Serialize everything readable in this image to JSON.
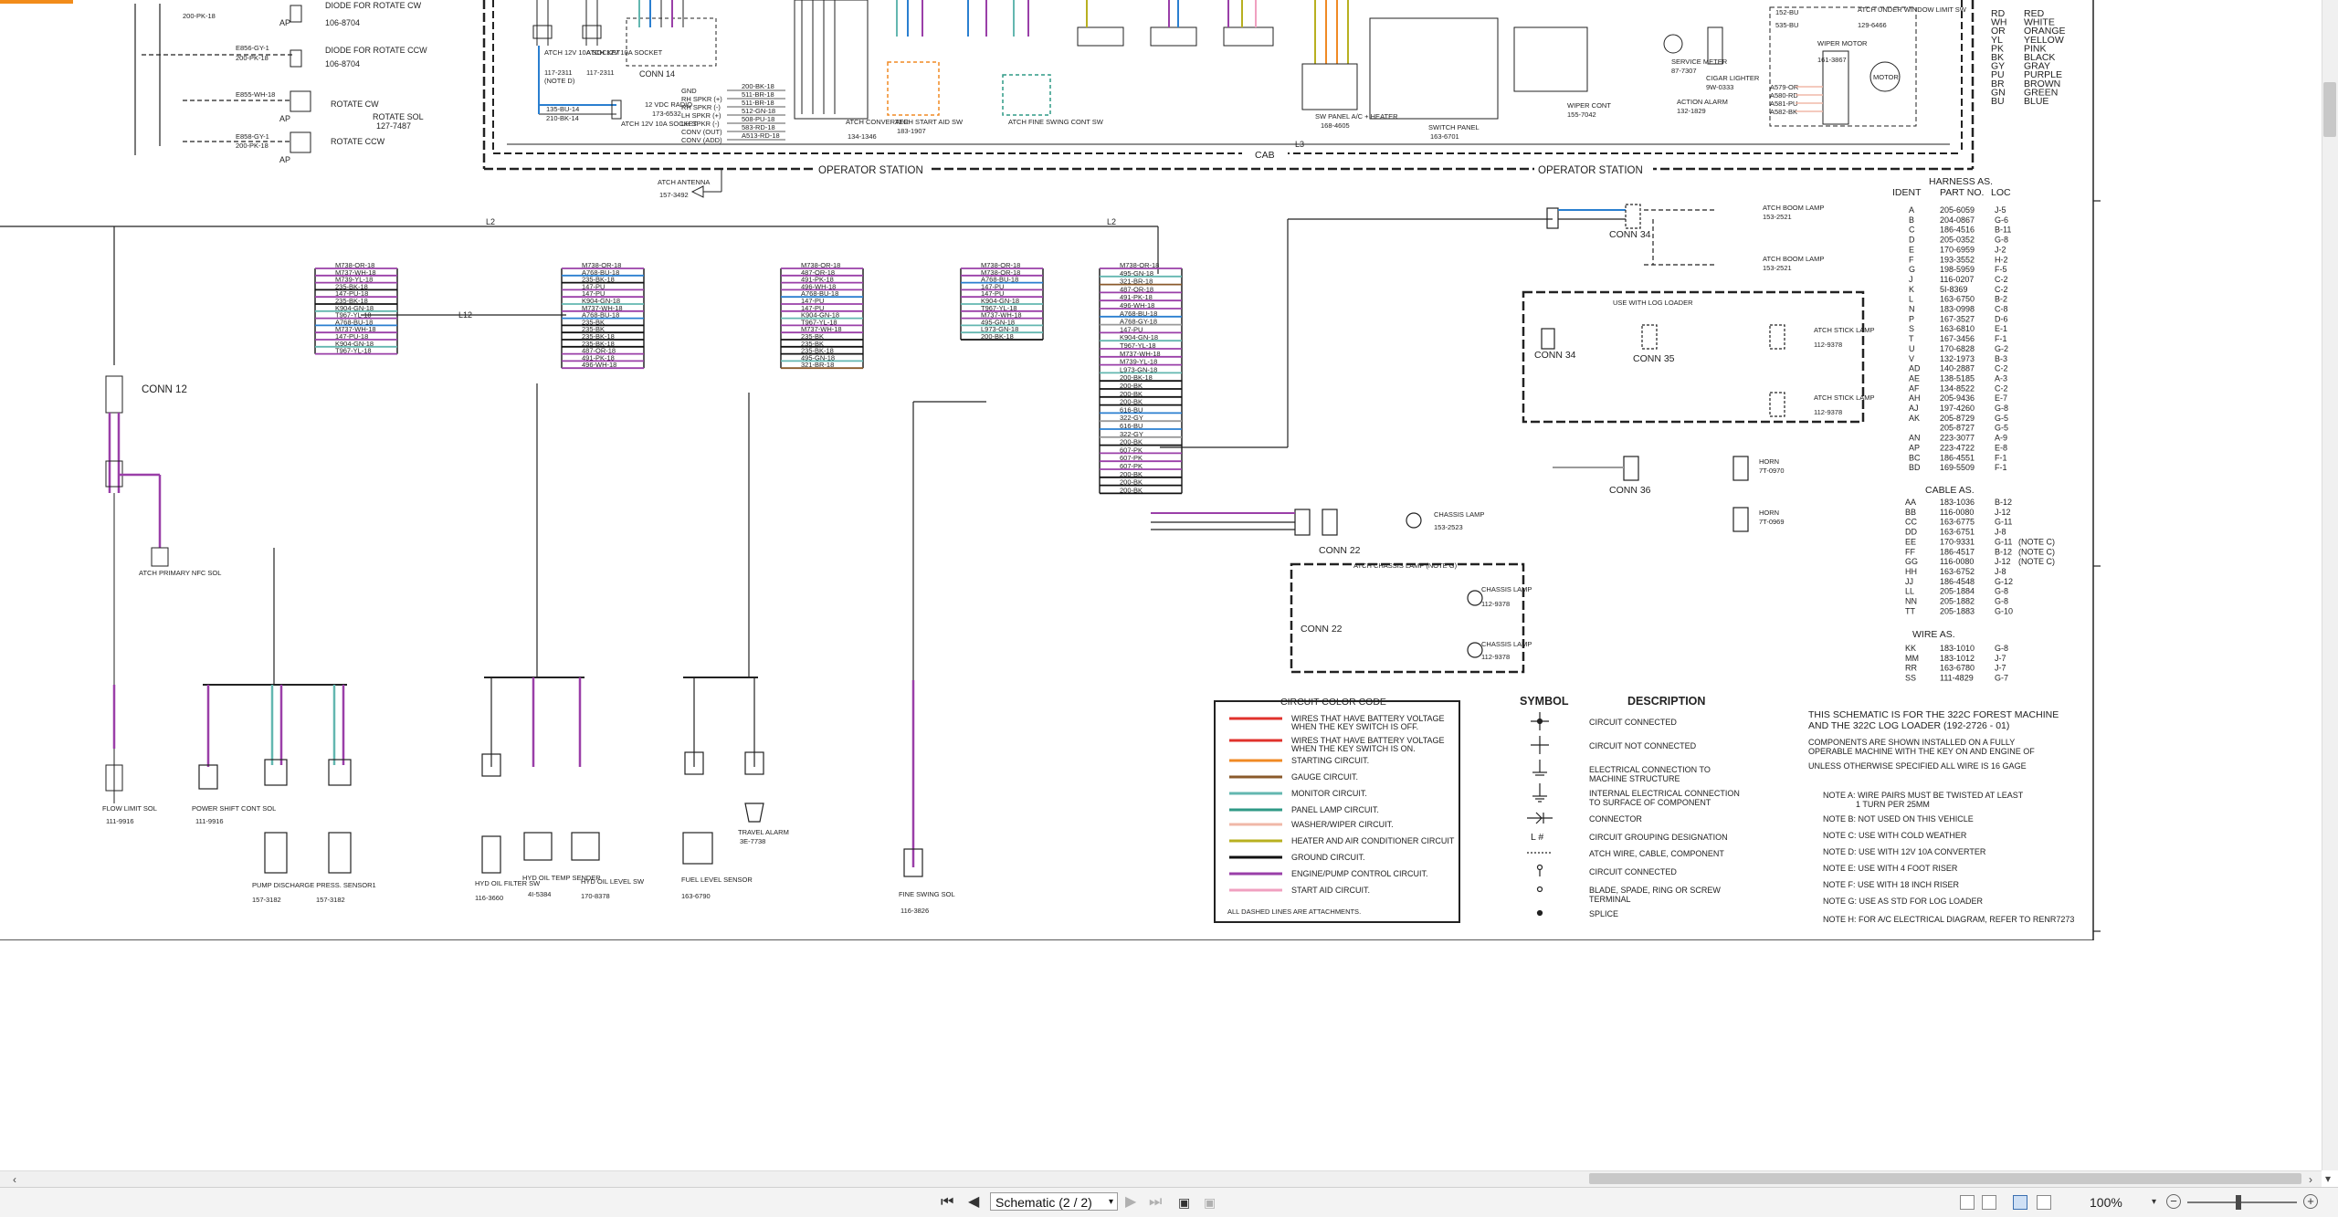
{
  "page_indicator": "Schematic (2 / 2)",
  "zoom": "100%",
  "grid": {
    "cols": [
      "8",
      "7",
      "6",
      "5",
      "4",
      "3",
      "2",
      "1"
    ],
    "rows": [
      "D",
      "C",
      "B",
      "A"
    ]
  },
  "colors": {
    "battery": "#e0322c",
    "keyswitch": "#e0322c",
    "starting": "#f08a24",
    "gauge": "#8a5a2b",
    "monitor": "#63b7b0",
    "panel_lamp": "#2f9a86",
    "washer": "#f0b8a8",
    "heater": "#b8b020",
    "ground": "#111111",
    "engine_pump": "#9a3fa8",
    "start_aid": "#f0a0c0",
    "blue_wire": "#2a7fd0"
  },
  "top": {
    "diode_cw": "DIODE FOR ROTATE CW",
    "diode_cw_pn": "106-8704",
    "diode_ccw": "DIODE FOR ROTATE CCW",
    "diode_ccw_pn": "106-8704",
    "wire_e856": "E856-GY-1",
    "wire_e855": "E855-WH-18",
    "wire_e858": "E858-GY-1",
    "wire_200pk": "200-PK-18",
    "rotate_cw": "ROTATE CW",
    "rotate_ccw": "ROTATE CCW",
    "rotate_sol": "ROTATE SOL",
    "rotate_sol_pn": "127-7487",
    "ap": "AP",
    "atch_socket": "ATCH 12V 10A SOCKET",
    "atch_socket_pn": "117-2311",
    "note_d": "(NOTE D)",
    "conn14": "CONN 14",
    "radio": "12 VDC RADIO",
    "radio_pn": "173-6532",
    "atch_converter": "ATCH CONVERTER",
    "converter_pn": "134-1346",
    "atch_start_aid": "ATCH START AID SW",
    "start_aid_pn": "183-1907",
    "atch_fine_swing": "ATCH FINE SWING CONT SW",
    "cab": "CAB",
    "operator_station": "OPERATOR STATION",
    "atch_antenna": "ATCH ANTENNA",
    "antenna_pn": "157-3492",
    "sw_panel": "SW PANEL A/C + HEATER",
    "sw_panel_pn": "168-4605",
    "switch_panel": "SWITCH PANEL",
    "switch_panel_pn": "163-6701",
    "wiper_cont": "WIPER CONT",
    "wiper_cont_pn": "155-7042",
    "action_alarm": "ACTION ALARM",
    "action_alarm_pn": "132-1829",
    "service_meter": "SERVICE METER",
    "service_meter_pn": "87-7307",
    "cigar_lighter": "CIGAR LIGHTER",
    "cigar_pn": "9W-0333",
    "wiper_motor": "WIPER MOTOR",
    "wiper_motor_pn": "161-3867",
    "motor": "MOTOR",
    "atch_under_window": "ATCH UNDER WINDOW LIMIT SW",
    "under_window_pn": "129-6466",
    "l3": "L3",
    "radio_wires": [
      "GND",
      "RH SPKR (+)",
      "RH SPKR (-)",
      "LH SPKR (+)",
      "LH SPKR (-)",
      "CONV (OUT)",
      "CONV (ADD)"
    ],
    "radio_nums": [
      "200-BK-18",
      "511-BR-18",
      "511-BR-18",
      "512-GN-18",
      "508-PU-18",
      "583-RD-18",
      "A513-RD-18"
    ],
    "wiper_wires": [
      "A579-OR",
      "A580-RD",
      "A581-PU",
      "A582-BK"
    ],
    "wire_152": "152-BU",
    "wire_535": "535-BU",
    "wire_135": "135-BU-14",
    "wire_210": "210-BK-14"
  },
  "colors_legend": [
    {
      "code": "RD",
      "name": "RED"
    },
    {
      "code": "WH",
      "name": "WHITE"
    },
    {
      "code": "OR",
      "name": "ORANGE"
    },
    {
      "code": "YL",
      "name": "YELLOW"
    },
    {
      "code": "PK",
      "name": "PINK"
    },
    {
      "code": "BK",
      "name": "BLACK"
    },
    {
      "code": "GY",
      "name": "GRAY"
    },
    {
      "code": "PU",
      "name": "PURPLE"
    },
    {
      "code": "BR",
      "name": "BROWN"
    },
    {
      "code": "GN",
      "name": "GREEN"
    },
    {
      "code": "BU",
      "name": "BLUE"
    }
  ],
  "harness": {
    "title": "HARNESS AS.",
    "headers": [
      "IDENT",
      "PART NO.",
      "LOC"
    ],
    "rows": [
      [
        "A",
        "205-6059",
        "J-5"
      ],
      [
        "B",
        "204-0867",
        "G-6"
      ],
      [
        "C",
        "186-4516",
        "B-11"
      ],
      [
        "D",
        "205-0352",
        "G-8"
      ],
      [
        "E",
        "170-6959",
        "J-2"
      ],
      [
        "F",
        "193-3552",
        "H-2"
      ],
      [
        "G",
        "198-5959",
        "F-5"
      ],
      [
        "J",
        "116-0207",
        "C-2"
      ],
      [
        "K",
        "5I-8369",
        "C-2"
      ],
      [
        "L",
        "163-6750",
        "B-2"
      ],
      [
        "N",
        "183-0998",
        "C-8"
      ],
      [
        "P",
        "167-3527",
        "D-6"
      ],
      [
        "S",
        "163-6810",
        "E-1"
      ],
      [
        "T",
        "167-3456",
        "F-1"
      ],
      [
        "U",
        "170-6828",
        "G-2"
      ],
      [
        "V",
        "132-1973",
        "B-3"
      ],
      [
        "AD",
        "140-2887",
        "C-2"
      ],
      [
        "AE",
        "138-5185",
        "A-3"
      ],
      [
        "AF",
        "134-8522",
        "C-2"
      ],
      [
        "AH",
        "205-9436",
        "E-7"
      ],
      [
        "AJ",
        "197-4260",
        "G-8"
      ],
      [
        "AK",
        "205-8729",
        "G-5"
      ],
      [
        "",
        "205-8727",
        "G-5"
      ],
      [
        "AN",
        "223-3077",
        "A-9"
      ],
      [
        "AP",
        "223-4722",
        "E-8"
      ],
      [
        "BC",
        "186-4551",
        "F-1"
      ],
      [
        "BD",
        "169-5509",
        "F-1"
      ]
    ]
  },
  "cable": {
    "title": "CABLE AS.",
    "rows": [
      [
        "AA",
        "183-1036",
        "B-12",
        ""
      ],
      [
        "BB",
        "116-0080",
        "J-12",
        ""
      ],
      [
        "CC",
        "163-6775",
        "G-11",
        ""
      ],
      [
        "DD",
        "163-6751",
        "J-8",
        ""
      ],
      [
        "EE",
        "170-9331",
        "G-11",
        "(NOTE C)"
      ],
      [
        "FF",
        "186-4517",
        "B-12",
        "(NOTE C)"
      ],
      [
        "GG",
        "116-0080",
        "J-12",
        "(NOTE C)"
      ],
      [
        "HH",
        "163-6752",
        "J-8",
        ""
      ],
      [
        "JJ",
        "186-4548",
        "G-12",
        ""
      ],
      [
        "LL",
        "205-1884",
        "G-8",
        ""
      ],
      [
        "NN",
        "205-1882",
        "G-8",
        ""
      ],
      [
        "TT",
        "205-1883",
        "G-10",
        ""
      ]
    ]
  },
  "wire": {
    "title": "WIRE AS.",
    "rows": [
      [
        "KK",
        "183-1010",
        "G-8"
      ],
      [
        "MM",
        "183-1012",
        "J-7"
      ],
      [
        "RR",
        "163-6780",
        "J-7"
      ],
      [
        "SS",
        "111-4829",
        "G-7"
      ]
    ]
  },
  "circuit_legend": {
    "title": "CIRCUIT COLOR CODE",
    "items": [
      {
        "c": "#e0322c",
        "t1": "WIRES THAT HAVE BATTERY VOLTAGE",
        "t2": "WHEN THE KEY SWITCH IS OFF."
      },
      {
        "c": "#e0322c",
        "t1": "WIRES THAT HAVE BATTERY VOLTAGE",
        "t2": "WHEN THE KEY SWITCH IS ON."
      },
      {
        "c": "#f08a24",
        "t1": "STARTING CIRCUIT.",
        "t2": ""
      },
      {
        "c": "#8a5a2b",
        "t1": "GAUGE CIRCUIT.",
        "t2": ""
      },
      {
        "c": "#63b7b0",
        "t1": "MONITOR CIRCUIT.",
        "t2": ""
      },
      {
        "c": "#2f9a86",
        "t1": "PANEL LAMP CIRCUIT.",
        "t2": ""
      },
      {
        "c": "#f0b8a8",
        "t1": "WASHER/WIPER CIRCUIT.",
        "t2": ""
      },
      {
        "c": "#b8b020",
        "t1": "HEATER AND AIR CONDITIONER CIRCUIT",
        "t2": ""
      },
      {
        "c": "#111111",
        "t1": "GROUND CIRCUIT.",
        "t2": ""
      },
      {
        "c": "#9a3fa8",
        "t1": "ENGINE/PUMP CONTROL CIRCUIT.",
        "t2": ""
      },
      {
        "c": "#f0a0c0",
        "t1": "START AID CIRCUIT.",
        "t2": ""
      }
    ],
    "footer": "ALL DASHED LINES ARE ATTACHMENTS."
  },
  "symbol_legend": {
    "title_symbol": "SYMBOL",
    "title_desc": "DESCRIPTION",
    "items": [
      {
        "sym": "connected",
        "d1": "CIRCUIT CONNECTED",
        "d2": ""
      },
      {
        "sym": "notconnected",
        "d1": "CIRCUIT NOT CONNECTED",
        "d2": ""
      },
      {
        "sym": "chassis",
        "d1": "ELECTRICAL CONNECTION TO",
        "d2": "MACHINE STRUCTURE"
      },
      {
        "sym": "internal",
        "d1": "INTERNAL ELECTRICAL CONNECTION",
        "d2": "TO SURFACE OF COMPONENT"
      },
      {
        "sym": "connector",
        "d1": "CONNECTOR",
        "d2": ""
      },
      {
        "sym": "group",
        "d1": "CIRCUIT GROUPING DESIGNATION",
        "d2": ""
      },
      {
        "sym": "dotted",
        "d1": "ATCH WIRE, CABLE, COMPONENT",
        "d2": ""
      },
      {
        "sym": "openconn",
        "d1": "CIRCUIT CONNECTED",
        "d2": ""
      },
      {
        "sym": "blade",
        "d1": "BLADE, SPADE, RING OR SCREW",
        "d2": "TERMINAL"
      },
      {
        "sym": "splice",
        "d1": "SPLICE",
        "d2": ""
      }
    ],
    "group_symbol": "L #"
  },
  "notes": {
    "title1": "THIS SCHEMATIC IS FOR THE 322C FOREST MACHINE",
    "title2": "AND THE 322C LOG LOADER  (192-2726 - 01)",
    "line1": "COMPONENTS ARE SHOWN INSTALLED ON A FULLY",
    "line2": "OPERABLE MACHINE WITH THE KEY ON AND ENGINE OF",
    "line3": "UNLESS OTHERWISE SPECIFIED ALL WIRE IS 16 GAGE",
    "items": [
      "NOTE A: WIRE PAIRS MUST BE TWISTED AT LEAST",
      "1 TURN PER 25MM",
      "NOTE B: NOT USED ON THIS VEHICLE",
      "NOTE C: USE WITH COLD WEATHER",
      "NOTE D: USE WITH 12V 10A CONVERTER",
      "NOTE E: USE WITH 4 FOOT RISER",
      "NOTE F: USE WITH 18 INCH RISER",
      "NOTE G: USE AS STD FOR LOG LOADER",
      "NOTE H: FOR A/C ELECTRICAL DIAGRAM, REFER TO RENR7273"
    ]
  },
  "components": {
    "conn12": "CONN 12",
    "atch_primary": "ATCH PRIMARY NFC SOL",
    "flow_limit": "FLOW LIMIT SOL",
    "flow_limit_pn": "111-9916",
    "power_shift": "POWER SHIFT CONT SOL",
    "power_shift_pn": "111-9916",
    "pump_discharge1": "PUMP DISCHARGE PRESS. SENSOR1",
    "pump_discharge1_pn": "157-3182",
    "pump_discharge2": "PUMP DISCHARGE PRESS. SENSOR2",
    "pump_discharge2_pn": "157-3182",
    "hyd_oil_filter": "HYD OIL FILTER SW",
    "hyd_oil_filter_pn": "116-3660",
    "hyd_oil_temp": "HYD OIL TEMP SENDER",
    "hyd_oil_temp_pn": "4I-5384",
    "hyd_oil_level": "HYD OIL LEVEL SW",
    "hyd_oil_level_pn": "170-8378",
    "fuel_level": "FUEL LEVEL SENSOR",
    "fuel_level_pn": "163-6790",
    "travel_alarm": "TRAVEL ALARM",
    "travel_alarm_pn": "3E-7738",
    "fine_swing": "FINE SWING SOL",
    "fine_swing_pn": "116-3826",
    "atch_boom_lamp": "ATCH BOOM LAMP",
    "boom_lamp_pn": "153-2521",
    "conn34": "CONN 34",
    "conn35": "CONN 35",
    "conn36": "CONN 36",
    "conn22": "CONN 22",
    "use_with_log": "USE WITH LOG LOADER",
    "atch_stick_lamp": "ATCH STICK LAMP",
    "stick_lamp_pn": "112-9378",
    "horn": "HORN",
    "horn1_pn": "7T-0970",
    "horn2_pn": "7T-0969",
    "chassis_lamp": "CHASSIS LAMP",
    "chassis_lamp_pn": "153-2523",
    "atch_chassis_lamp": "ATCH CHASSIS LAMP (NOTE G)",
    "chassis_lamp2_pn": "112-9378",
    "l2": "L2",
    "l12": "L12",
    "ground": "GROUND"
  },
  "bundles": {
    "b1": [
      "M738-OR-18",
      "M737-WH-18",
      "M739-YL-18",
      "235-BK-18",
      "147-PU-18",
      "235-BK-18",
      "K904-GN-18",
      "T967-YL-18",
      "A768-BU-18",
      "M737-WH-18",
      "147-PU-18",
      "K904-GN-18",
      "T967-YL-18"
    ],
    "b2": [
      "M738-OR-18",
      "A768-BU-18",
      "235-BK-18",
      "147-PU",
      "147-PU",
      "K904-GN-18",
      "M737-WH-18",
      "A768-BU-18",
      "235-BK",
      "235-BK",
      "235-BK-18",
      "235-BK-18",
      "487-OR-18",
      "491-PK-18",
      "496-WH-18"
    ],
    "b3": [
      "M738-OR-18",
      "487-OR-18",
      "491-PK-18",
      "496-WH-18",
      "A768-BU-18",
      "147-PU",
      "147-PU",
      "K904-GN-18",
      "T967-YL-18",
      "M737-WH-18",
      "235-BK",
      "235-BK",
      "235-BK-18",
      "495-GN-18",
      "321-BR-18"
    ],
    "b4": [
      "M738-OR-18",
      "M738-OR-18",
      "A768-BU-18",
      "147-PU",
      "147-PU",
      "K904-GN-18",
      "T967-YL-18",
      "M737-WH-18",
      "495-GN-18",
      "L973-GN-18",
      "200-BK-18"
    ],
    "b5": [
      "M738-OR-18",
      "495-GN-18",
      "321-BR-18",
      "487-OR-18",
      "491-PK-18",
      "496-WH-18",
      "A768-BU-18",
      "A768-GY-18",
      "147-PU",
      "K904-GN-18",
      "T967-YL-18",
      "M737-WH-18",
      "M739-YL-18",
      "L973-GN-18",
      "200-BK-18",
      "200-BK",
      "200-BK",
      "200-BK",
      "616-BU",
      "322-GY",
      "616-BU",
      "322-GY",
      "200-BK",
      "607-PK",
      "607-PK",
      "607-PK",
      "200-BK",
      "200-BK",
      "200-BK"
    ]
  }
}
